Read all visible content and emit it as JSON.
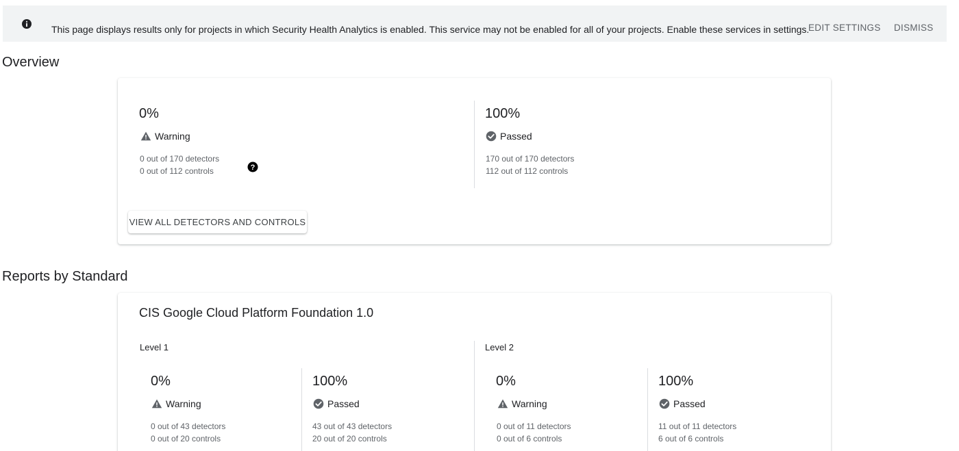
{
  "banner": {
    "message": "This page displays results only for projects in which Security Health Analytics is enabled. This service may not be enabled for all of your projects. Enable these services in settings.",
    "edit_settings": "EDIT SETTINGS",
    "dismiss": "DISMISS",
    "icon": "info-icon"
  },
  "overview": {
    "title": "Overview",
    "warning": {
      "percent": "0%",
      "label": "Warning",
      "detectors": "0 out of 170 detectors",
      "controls": "0 out of 112 controls"
    },
    "passed": {
      "percent": "100%",
      "label": "Passed",
      "detectors": "170 out of 170 detectors",
      "controls": "112 out of 112 controls"
    },
    "view_all_button": "VIEW ALL DETECTORS AND CONTROLS"
  },
  "reports": {
    "title": "Reports by Standard",
    "standards": [
      {
        "name": "CIS Google Cloud Platform Foundation 1.0",
        "levels": [
          {
            "label": "Level 1",
            "warning": {
              "percent": "0%",
              "label": "Warning",
              "detectors": "0 out of 43 detectors",
              "controls": "0 out of 20 controls"
            },
            "passed": {
              "percent": "100%",
              "label": "Passed",
              "detectors": "43 out of 43 detectors",
              "controls": "20 out of 20 controls"
            }
          },
          {
            "label": "Level 2",
            "warning": {
              "percent": "0%",
              "label": "Warning",
              "detectors": "0 out of 11 detectors",
              "controls": "0 out of 6 controls"
            },
            "passed": {
              "percent": "100%",
              "label": "Passed",
              "detectors": "11 out of 11 detectors",
              "controls": "6 out of 6 controls"
            }
          }
        ]
      }
    ]
  },
  "colors": {
    "banner_bg": "#f1f3f4",
    "text_primary": "#202124",
    "text_secondary": "#5f6368",
    "icon_gray": "#5f6368"
  }
}
